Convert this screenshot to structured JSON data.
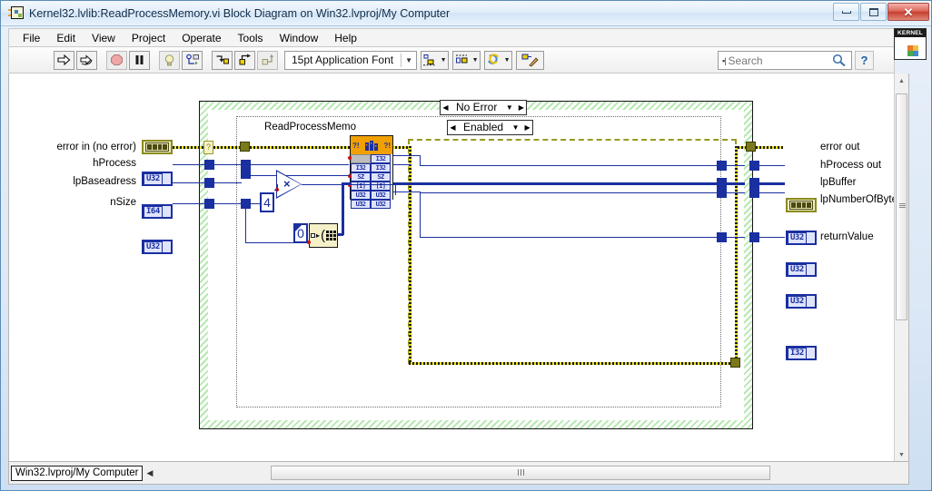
{
  "window": {
    "title": "Kernel32.lvlib:ReadProcessMemory.vi Block Diagram on Win32.lvproj/My Computer",
    "minimize_label": "",
    "maximize_label": "",
    "close_label": "✕"
  },
  "menu": {
    "items": [
      {
        "label": "File"
      },
      {
        "label": "Edit"
      },
      {
        "label": "View"
      },
      {
        "label": "Project"
      },
      {
        "label": "Operate"
      },
      {
        "label": "Tools"
      },
      {
        "label": "Window"
      },
      {
        "label": "Help"
      }
    ]
  },
  "toolbar": {
    "run_icon": "run-arrow-icon",
    "run_continuous_icon": "run-continuously-icon",
    "abort_icon": "abort-execution-icon",
    "pause_icon": "pause-icon",
    "highlight_icon": "highlight-execution-bulb-icon",
    "retain_values_icon": "retain-wire-values-icon",
    "step_into_icon": "step-into-icon",
    "step_over_icon": "step-over-icon",
    "step_out_icon": "step-out-icon",
    "font_label": "15pt Application Font",
    "align_icon": "align-objects-icon",
    "distribute_icon": "distribute-objects-icon",
    "reorder_icon": "reorder-objects-icon",
    "cleanup_icon": "clean-up-diagram-icon",
    "help_label": "?",
    "vi_icon_caption": "KERNEL"
  },
  "search": {
    "placeholder": "Search",
    "search_icon": "magnifier-icon",
    "prefix_icon": "search-scope-icon"
  },
  "diagram": {
    "disable_structure": {
      "selector": "Enabled",
      "left_arrow": "◀",
      "right_arrow": "▶",
      "dropdown_arrow": "▼"
    },
    "case_structure": {
      "selector": "No Error",
      "left_arrow": "◀",
      "right_arrow": "▶",
      "dropdown_arrow": "▼"
    },
    "cln_node": {
      "label": "ReadProcessMemo",
      "question_mark": "?!",
      "rows": [
        {
          "left": "",
          "right": "I32"
        },
        {
          "left": "I32",
          "right": "I32"
        },
        {
          "left": "SZ",
          "right": "SZ"
        },
        {
          "left": "[I]",
          "right": "[I]"
        },
        {
          "left": "U32",
          "right": "U32"
        },
        {
          "left": "U32",
          "right": "U32"
        }
      ]
    },
    "inputs": [
      {
        "label": "error in (no error)",
        "type": "error",
        "type_text": "⌸⌸"
      },
      {
        "label": "hProcess",
        "type": "U32",
        "type_text": "U32"
      },
      {
        "label": "lpBaseadress",
        "type": "I64",
        "type_text": "I64"
      },
      {
        "label": "nSize",
        "type": "U32",
        "type_text": "U32"
      }
    ],
    "outputs": [
      {
        "label": "error out",
        "type": "error",
        "type_text": "⌸⌸"
      },
      {
        "label": "hProcess out",
        "type": "U32",
        "type_text": "U32"
      },
      {
        "label": "lpBuffer",
        "type": "U32",
        "type_text": "U32"
      },
      {
        "label": "lpNumberOfBytesRe",
        "type": "U32",
        "type_text": "U32"
      },
      {
        "label": "returnValue",
        "type": "I32",
        "type_text": "I32"
      }
    ],
    "constants": [
      {
        "name": "multiply-constant",
        "value": "4"
      },
      {
        "name": "initialize-array-element-constant",
        "value": "0"
      }
    ],
    "multiply_node": {
      "symbol": "×",
      "name": "multiply-function"
    },
    "initialize_array_node": {
      "name": "initialize-array-function",
      "arrow": "▸"
    }
  },
  "statusbar": {
    "context": "Win32.lvproj/My Computer",
    "context_arrow": "◀"
  },
  "colors": {
    "structure_green": "#b6e8b0",
    "cln_orange": "#f0a000",
    "wire_blue": "#1a2fa0",
    "error_yellow": "#e8e020",
    "error_olive": "#7a7a1a"
  }
}
